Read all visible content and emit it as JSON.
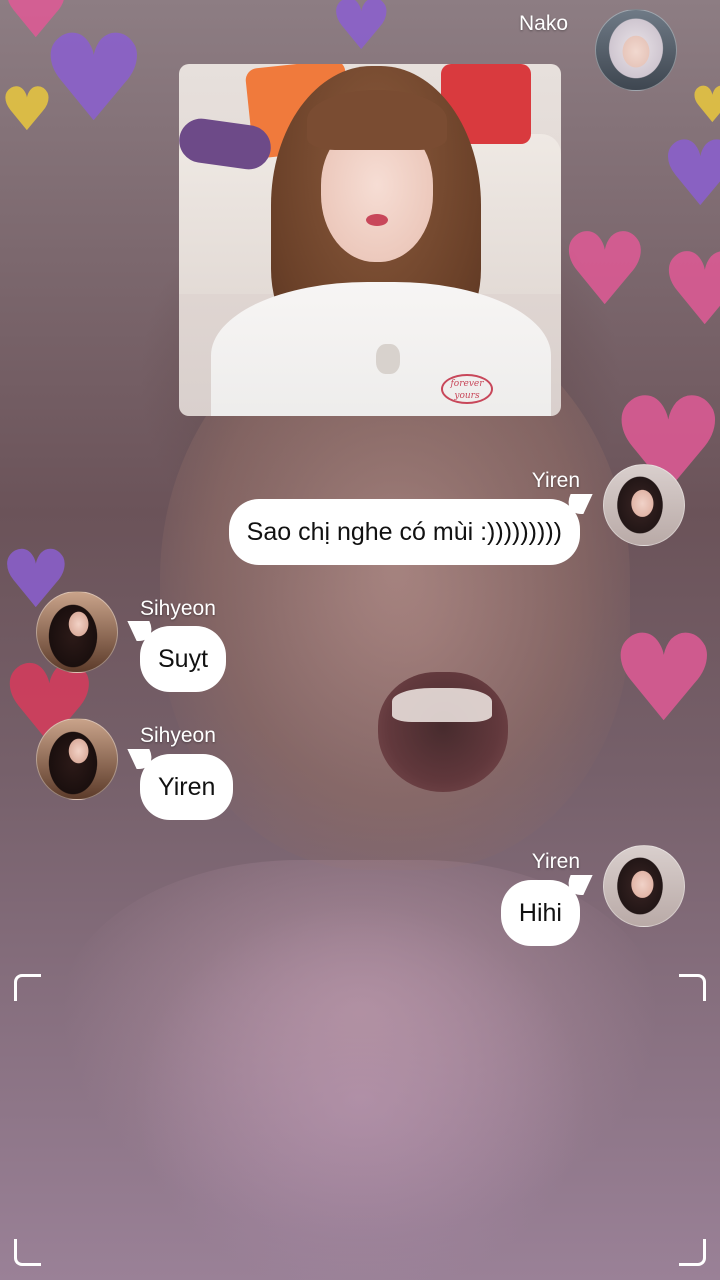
{
  "chat": {
    "messages": [
      {
        "sender": "Nako",
        "side": "right",
        "kind": "image",
        "avatar": "nako-avatar"
      },
      {
        "sender": "Yiren",
        "side": "right",
        "kind": "text",
        "text": "Sao chị nghe có mùi :)))))))))",
        "avatar": "yiren-avatar"
      },
      {
        "sender": "Sihyeon",
        "side": "left",
        "kind": "text",
        "text": "Suỵt",
        "avatar": "sihyeon-avatar"
      },
      {
        "sender": "Sihyeon",
        "side": "left",
        "kind": "text",
        "text": "Yiren",
        "avatar": "sihyeon-avatar"
      },
      {
        "sender": "Yiren",
        "side": "right",
        "kind": "text",
        "text": "Hihi",
        "avatar": "yiren-avatar"
      }
    ]
  },
  "photo": {
    "logo_text": "forever yours"
  },
  "colors": {
    "bubble": "#ffffff",
    "bubble_text": "#111111",
    "sender_text": "#ffffff"
  },
  "icons": [
    "heart-icon",
    "frame-corner-icon"
  ]
}
